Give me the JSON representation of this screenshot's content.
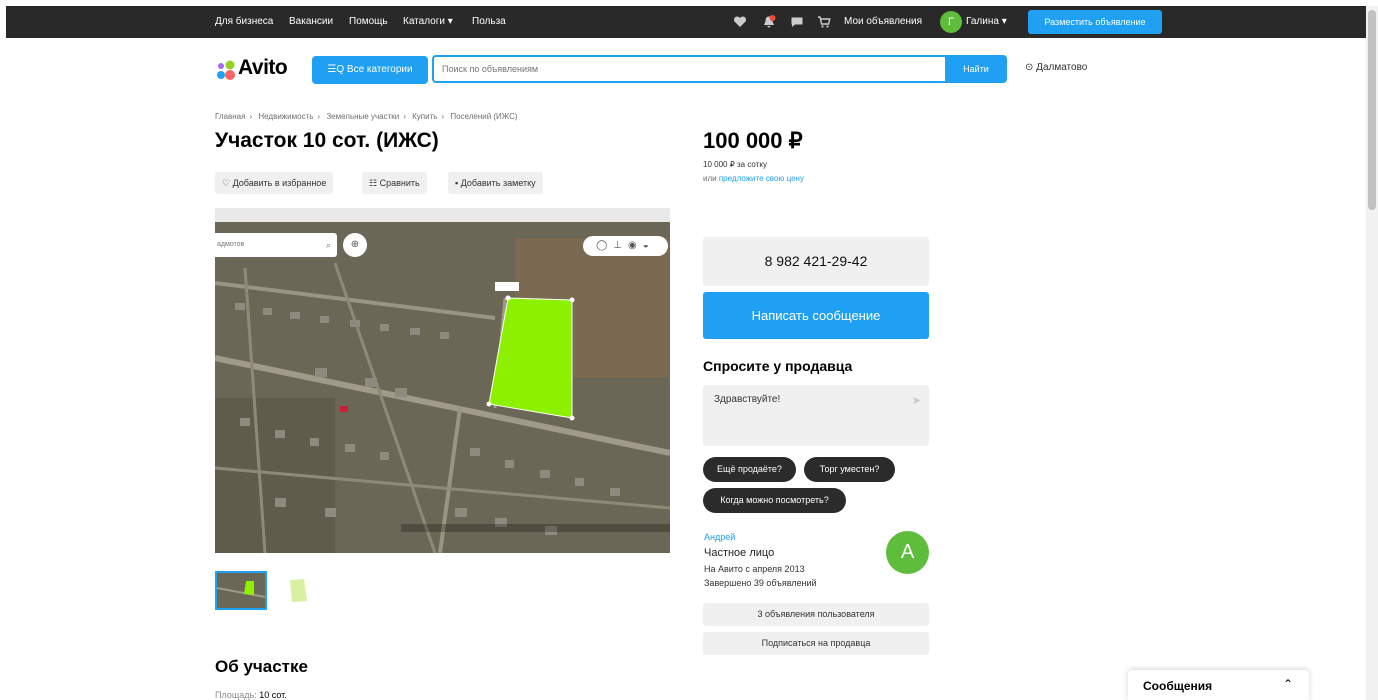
{
  "topbar": {
    "links": [
      "Для бизнеса",
      "Вакансии",
      "Помощь",
      "Каталоги",
      "Польза"
    ],
    "icons": [
      "heart-icon",
      "bell-icon",
      "chat-icon",
      "cart-icon"
    ],
    "notification_badge": "1",
    "my_ads": "Мои объявления",
    "user_initial": "Г",
    "user_name": "Галина",
    "place_ad": "Разместить объявление",
    "colors": {
      "bar": "#292929",
      "accent": "#1fa0f2",
      "avatar": "#5fbd3c"
    }
  },
  "header": {
    "logo": "Avito",
    "all_categories": "Все категории",
    "search_placeholder": "Поиск по объявлениям",
    "search_button": "Найти",
    "location": "Далматово"
  },
  "breadcrumbs": [
    "Главная",
    "Недвижимость",
    "Земельные участки",
    "Купить",
    "Поселений (ИЖС)"
  ],
  "listing": {
    "title": "Участок 10 сот. (ИЖС)",
    "actions": {
      "favorite": "Добавить в избранное",
      "compare": "Сравнить",
      "note": "Добавить заметку"
    },
    "map": {
      "search_text": "адмотов"
    },
    "about_heading": "Об участке",
    "area_label": "Площадь:",
    "area_value": "10 сот."
  },
  "sidebar": {
    "price": "100 000 ₽",
    "price_per": "10 000 ₽ за сотку",
    "offer_prefix": "или",
    "offer_link": "предложите свою цену",
    "phone": "8 982 421-29-42",
    "write_message": "Написать сообщение",
    "ask_heading": "Спросите у продавца",
    "ask_text": "Здравствуйте!",
    "quick_replies": [
      "Ещё продаёте?",
      "Торг уместен?",
      "Когда можно посмотреть?"
    ],
    "seller": {
      "name": "Андрей",
      "type": "Частное лицо",
      "since": "На Авито с апреля 2013",
      "completed": "Завершено 39 объявлений",
      "initial": "А"
    },
    "user_ads": "3 объявления пользователя",
    "subscribe": "Подписаться на продавца"
  },
  "messages_panel": {
    "label": "Сообщения"
  }
}
